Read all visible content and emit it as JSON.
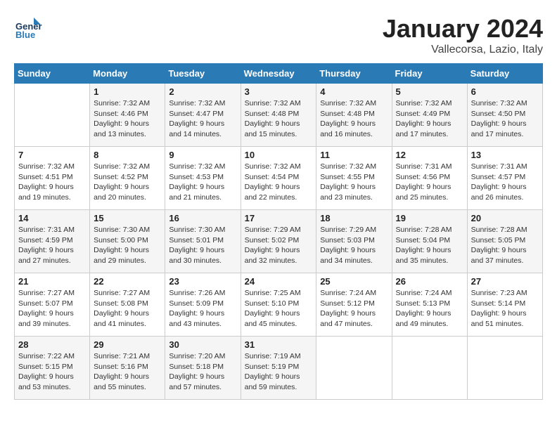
{
  "header": {
    "logo_general": "General",
    "logo_blue": "Blue",
    "month_title": "January 2024",
    "subtitle": "Vallecorsa, Lazio, Italy"
  },
  "weekdays": [
    "Sunday",
    "Monday",
    "Tuesday",
    "Wednesday",
    "Thursday",
    "Friday",
    "Saturday"
  ],
  "weeks": [
    [
      {
        "day": "",
        "info": ""
      },
      {
        "day": "1",
        "info": "Sunrise: 7:32 AM\nSunset: 4:46 PM\nDaylight: 9 hours\nand 13 minutes."
      },
      {
        "day": "2",
        "info": "Sunrise: 7:32 AM\nSunset: 4:47 PM\nDaylight: 9 hours\nand 14 minutes."
      },
      {
        "day": "3",
        "info": "Sunrise: 7:32 AM\nSunset: 4:48 PM\nDaylight: 9 hours\nand 15 minutes."
      },
      {
        "day": "4",
        "info": "Sunrise: 7:32 AM\nSunset: 4:48 PM\nDaylight: 9 hours\nand 16 minutes."
      },
      {
        "day": "5",
        "info": "Sunrise: 7:32 AM\nSunset: 4:49 PM\nDaylight: 9 hours\nand 17 minutes."
      },
      {
        "day": "6",
        "info": "Sunrise: 7:32 AM\nSunset: 4:50 PM\nDaylight: 9 hours\nand 17 minutes."
      }
    ],
    [
      {
        "day": "7",
        "info": "Sunrise: 7:32 AM\nSunset: 4:51 PM\nDaylight: 9 hours\nand 19 minutes."
      },
      {
        "day": "8",
        "info": "Sunrise: 7:32 AM\nSunset: 4:52 PM\nDaylight: 9 hours\nand 20 minutes."
      },
      {
        "day": "9",
        "info": "Sunrise: 7:32 AM\nSunset: 4:53 PM\nDaylight: 9 hours\nand 21 minutes."
      },
      {
        "day": "10",
        "info": "Sunrise: 7:32 AM\nSunset: 4:54 PM\nDaylight: 9 hours\nand 22 minutes."
      },
      {
        "day": "11",
        "info": "Sunrise: 7:32 AM\nSunset: 4:55 PM\nDaylight: 9 hours\nand 23 minutes."
      },
      {
        "day": "12",
        "info": "Sunrise: 7:31 AM\nSunset: 4:56 PM\nDaylight: 9 hours\nand 25 minutes."
      },
      {
        "day": "13",
        "info": "Sunrise: 7:31 AM\nSunset: 4:57 PM\nDaylight: 9 hours\nand 26 minutes."
      }
    ],
    [
      {
        "day": "14",
        "info": "Sunrise: 7:31 AM\nSunset: 4:59 PM\nDaylight: 9 hours\nand 27 minutes."
      },
      {
        "day": "15",
        "info": "Sunrise: 7:30 AM\nSunset: 5:00 PM\nDaylight: 9 hours\nand 29 minutes."
      },
      {
        "day": "16",
        "info": "Sunrise: 7:30 AM\nSunset: 5:01 PM\nDaylight: 9 hours\nand 30 minutes."
      },
      {
        "day": "17",
        "info": "Sunrise: 7:29 AM\nSunset: 5:02 PM\nDaylight: 9 hours\nand 32 minutes."
      },
      {
        "day": "18",
        "info": "Sunrise: 7:29 AM\nSunset: 5:03 PM\nDaylight: 9 hours\nand 34 minutes."
      },
      {
        "day": "19",
        "info": "Sunrise: 7:28 AM\nSunset: 5:04 PM\nDaylight: 9 hours\nand 35 minutes."
      },
      {
        "day": "20",
        "info": "Sunrise: 7:28 AM\nSunset: 5:05 PM\nDaylight: 9 hours\nand 37 minutes."
      }
    ],
    [
      {
        "day": "21",
        "info": "Sunrise: 7:27 AM\nSunset: 5:07 PM\nDaylight: 9 hours\nand 39 minutes."
      },
      {
        "day": "22",
        "info": "Sunrise: 7:27 AM\nSunset: 5:08 PM\nDaylight: 9 hours\nand 41 minutes."
      },
      {
        "day": "23",
        "info": "Sunrise: 7:26 AM\nSunset: 5:09 PM\nDaylight: 9 hours\nand 43 minutes."
      },
      {
        "day": "24",
        "info": "Sunrise: 7:25 AM\nSunset: 5:10 PM\nDaylight: 9 hours\nand 45 minutes."
      },
      {
        "day": "25",
        "info": "Sunrise: 7:24 AM\nSunset: 5:12 PM\nDaylight: 9 hours\nand 47 minutes."
      },
      {
        "day": "26",
        "info": "Sunrise: 7:24 AM\nSunset: 5:13 PM\nDaylight: 9 hours\nand 49 minutes."
      },
      {
        "day": "27",
        "info": "Sunrise: 7:23 AM\nSunset: 5:14 PM\nDaylight: 9 hours\nand 51 minutes."
      }
    ],
    [
      {
        "day": "28",
        "info": "Sunrise: 7:22 AM\nSunset: 5:15 PM\nDaylight: 9 hours\nand 53 minutes."
      },
      {
        "day": "29",
        "info": "Sunrise: 7:21 AM\nSunset: 5:16 PM\nDaylight: 9 hours\nand 55 minutes."
      },
      {
        "day": "30",
        "info": "Sunrise: 7:20 AM\nSunset: 5:18 PM\nDaylight: 9 hours\nand 57 minutes."
      },
      {
        "day": "31",
        "info": "Sunrise: 7:19 AM\nSunset: 5:19 PM\nDaylight: 9 hours\nand 59 minutes."
      },
      {
        "day": "",
        "info": ""
      },
      {
        "day": "",
        "info": ""
      },
      {
        "day": "",
        "info": ""
      }
    ]
  ]
}
